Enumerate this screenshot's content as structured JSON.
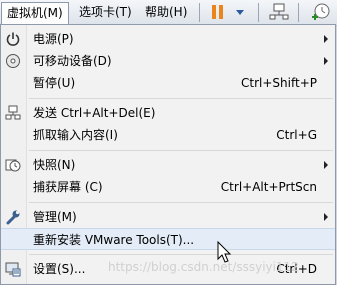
{
  "menubar": {
    "vm_menu": "虚拟机(M)",
    "tabs_menu": "选项卡(T)",
    "help_menu": "帮助(H)"
  },
  "menu": {
    "items": [
      {
        "label": "电源(P)",
        "shortcut": "",
        "submenu": true,
        "icon": "power-icon"
      },
      {
        "label": "可移动设备(D)",
        "shortcut": "",
        "submenu": true,
        "icon": "disc-icon"
      },
      {
        "label": "暂停(U)",
        "shortcut": "Ctrl+Shift+P",
        "submenu": false,
        "icon": ""
      },
      {
        "label": "发送 Ctrl+Alt+Del(E)",
        "shortcut": "",
        "submenu": false,
        "icon": "send-keys-icon"
      },
      {
        "label": "抓取输入内容(I)",
        "shortcut": "Ctrl+G",
        "submenu": false,
        "icon": ""
      },
      {
        "label": "快照(N)",
        "shortcut": "",
        "submenu": true,
        "icon": "snapshot-icon"
      },
      {
        "label": "捕获屏幕 (C)",
        "shortcut": "Ctrl+Alt+PrtScn",
        "submenu": false,
        "icon": ""
      },
      {
        "label": "管理(M)",
        "shortcut": "",
        "submenu": true,
        "icon": "wrench-icon"
      },
      {
        "label": "重新安装 VMware Tools(T)...",
        "shortcut": "",
        "submenu": false,
        "icon": ""
      },
      {
        "label": "设置(S)...",
        "shortcut": "Ctrl+D",
        "submenu": false,
        "icon": "settings-icon"
      }
    ]
  },
  "watermark": "https://blog.csdn.net/sssyiyi112",
  "colors": {
    "accent": "#e8851c",
    "hover": "#e3ecf7",
    "menu_bg": "#f2f2f2"
  }
}
